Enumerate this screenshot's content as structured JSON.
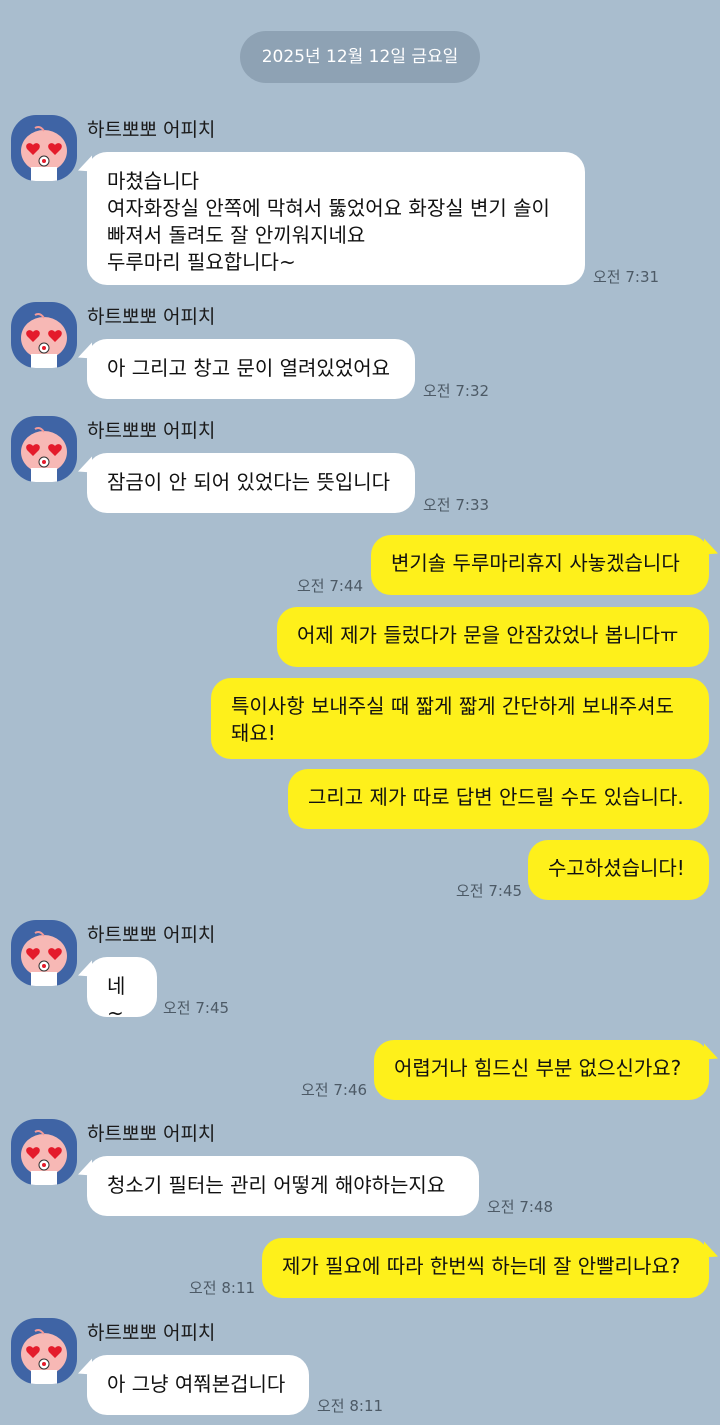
{
  "date_divider": "2025년 12월 12일 금요일",
  "sender_name": "하트뽀뽀 어피치",
  "messages": [
    {
      "dir": "in",
      "text": "마쳤습니다\n여자화장실 안쪽에 막혀서 뚫었어요 화장실 변기 솔이\n빠져서 돌려도 잘 안끼워지네요\n두루마리 필요합니다~",
      "time": "오전 7:31"
    },
    {
      "dir": "in",
      "text": "아 그리고 창고 문이 열려있었어요",
      "time": "오전 7:32"
    },
    {
      "dir": "in",
      "text": "잠금이 안 되어 있었다는 뜻입니다",
      "time": "오전 7:33"
    },
    {
      "dir": "out",
      "text": "변기솔 두루마리휴지 사놓겠습니다",
      "time": "오전 7:44"
    },
    {
      "dir": "out",
      "text": "어제 제가 들렀다가 문을 안잠갔었나 봅니다ㅠ",
      "time": ""
    },
    {
      "dir": "out",
      "text": "특이사항 보내주실 때 짧게 짧게 간단하게 보내주셔도\n돼요!",
      "time": ""
    },
    {
      "dir": "out",
      "text": "그리고 제가 따로 답변 안드릴 수도 있습니다.",
      "time": ""
    },
    {
      "dir": "out",
      "text": "수고하셨습니다!",
      "time": "오전 7:45"
    },
    {
      "dir": "in",
      "text": "네~",
      "time": "오전 7:45"
    },
    {
      "dir": "out",
      "text": "어렵거나 힘드신 부분 없으신가요?",
      "time": "오전 7:46"
    },
    {
      "dir": "in",
      "text": "청소기 필터는 관리 어떻게 해야하는지요",
      "time": "오전 7:48"
    },
    {
      "dir": "out",
      "text": "제가 필요에 따라 한번씩 하는데 잘 안빨리나요?",
      "time": "오전 8:11"
    },
    {
      "dir": "in",
      "text": "아 그냥 여쭤본겁니다",
      "time": "오전 8:11"
    }
  ],
  "avatar_icon": "apeach-heart-eyes-icon",
  "colors": {
    "background": "#a9bdce",
    "incoming_bubble": "#ffffff",
    "outgoing_bubble": "#fef01b",
    "avatar_bg": "#3f64a5"
  }
}
